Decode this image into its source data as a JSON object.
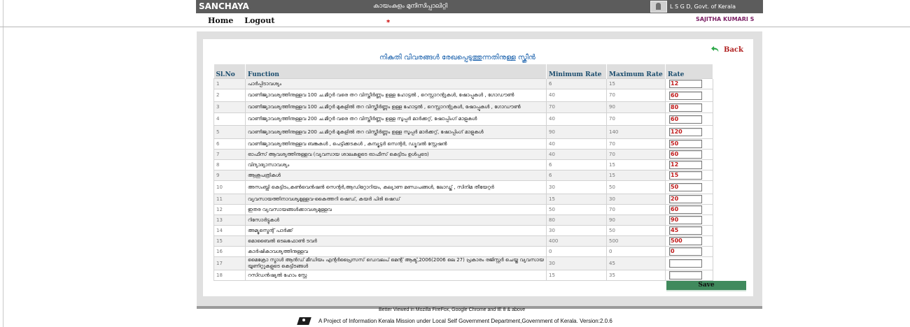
{
  "header": {
    "app_name": "SANCHAYA",
    "org_name": "കായംകുളം മുനിസിപ്പാലിറ്റി",
    "gov_name": "L S G D, Govt. of Kerala"
  },
  "user": {
    "name": "SAJITHA KUMARI S"
  },
  "nav": {
    "home": "Home",
    "logout": "Logout",
    "required_marker": "*"
  },
  "page": {
    "title": "നികുതി വിവരങ്ങൾ രേഖപ്പെടുത്തുന്നതിനുള്ള സ്ക്രീൻ",
    "back": "Back"
  },
  "table": {
    "headers": [
      "Sl.No",
      "Function",
      "Minimum Rate",
      "Maximum Rate",
      "Rate"
    ],
    "rows": [
      {
        "sl": "1",
        "fn": "പാർപ്പിടാവശ്യം",
        "min": "6",
        "max": "15",
        "rate": "12"
      },
      {
        "sl": "2",
        "fn": "വാണിജ്യാവശ്യത്തിനുള്ളവ 100 ച.മീറ്റർ വരെ തറ വിസ്തീർണ്ണം ഉള്ള ഹോട്ടൽ , റെസ്റ്റാറന്റുകൾ, ഷോപ്പുകൾ , ഗോഡൗൺ",
        "min": "40",
        "max": "70",
        "rate": "60"
      },
      {
        "sl": "3",
        "fn": "വാണിജ്യാവശ്യത്തിനുള്ളവ 100 ച.മീറ്റർ മുകളിൽ തറ വിസ്തീർണ്ണം ഉള്ള ഹോട്ടൽ , റെസ്റ്റാറന്റുകൾ, ഷോപ്പുകൾ , ഗോഡൗൺ",
        "min": "70",
        "max": "90",
        "rate": "80"
      },
      {
        "sl": "4",
        "fn": "വാണിജ്യാവശ്യത്തിനുള്ളവ 200 ച.മീറ്റർ വരെ തറ വിസ്തീർണ്ണം ഉള്ള സൂപ്പർ മാർക്കറ്റ്, ഷോപ്പിംഗ് മാളുകൾ",
        "min": "40",
        "max": "70",
        "rate": "60"
      },
      {
        "sl": "5",
        "fn": "വാണിജ്യാവശ്യത്തിനുള്ളവ 200 ച.മീറ്റർ മുകളിൽ തറ വിസ്തീർണ്ണം ഉള്ള സൂപ്പർ മാർക്കറ്റ്, ഷോപ്പിംഗ് മാളുകൾ",
        "min": "90",
        "max": "140",
        "rate": "120"
      },
      {
        "sl": "6",
        "fn": "വാണിജ്യാവശ്യത്തിനുള്ളവ ബങ്കുകൾ , പെട്ടിക്കടകൾ , കമ്പ്യൂട്ടർ സെന്റർ, ഡ്യൂവൽ സ്റ്റേഷൻ",
        "min": "40",
        "max": "70",
        "rate": "50"
      },
      {
        "sl": "7",
        "fn": "ഓഫീസ് ആവശ്യത്തിനുള്ളവ (വ്യവസായ ശാലകളുടെ ഓഫീസ് കെട്ടിടം ഉൾപ്പടെ)",
        "min": "40",
        "max": "70",
        "rate": "60"
      },
      {
        "sl": "8",
        "fn": "വിദ്യാഭ്യാസാവശ്യം",
        "min": "6",
        "max": "15",
        "rate": "12"
      },
      {
        "sl": "9",
        "fn": "ആശുപത്രികൾ",
        "min": "6",
        "max": "15",
        "rate": "15"
      },
      {
        "sl": "10",
        "fn": "അസംബ്ലി കെട്ടിടം,കൺവെൻഷൻ സെന്റർ,ആഡിറ്റോറിയം, കല്യാണ മണ്ഡപങ്ങൾ, ലോഡ്ജ് , സിനിമ തീയേറ്റർ",
        "min": "30",
        "max": "50",
        "rate": "50"
      },
      {
        "sl": "11",
        "fn": "വ്യവസായത്തിനാവശ്യമുള്ളവ-കൈത്തറി ഷെഡ്, കയർ പിരി ഷെഡ്",
        "min": "15",
        "max": "30",
        "rate": "20"
      },
      {
        "sl": "12",
        "fn": "ഇതര വ്യവസായങ്ങൾക്കാവശ്യമുള്ളവ",
        "min": "50",
        "max": "70",
        "rate": "60"
      },
      {
        "sl": "13",
        "fn": "റിസോർട്ടുകൾ",
        "min": "80",
        "max": "90",
        "rate": "90"
      },
      {
        "sl": "14",
        "fn": "അമ്യൂസ്മെന്റ് പാർക്ക്",
        "min": "30",
        "max": "50",
        "rate": "45"
      },
      {
        "sl": "15",
        "fn": "മൊബൈൽ ടെലഫോൺ ടവർ",
        "min": "400",
        "max": "500",
        "rate": "500"
      },
      {
        "sl": "16",
        "fn": "കാർഷികാവശ്യത്തിനുള്ളവ",
        "min": "0",
        "max": "0",
        "rate": "0"
      },
      {
        "sl": "17",
        "fn": "മൈക്രോ സ്മാൾ ആൻഡ് മീഡിയം എന്റർപ്രൈസസ് ഡെവലപ് മെന്റ് ആക്ട്,2006(2006 ലെ 27) പ്രകാരം രജിസ്റ്റർ ചെയ്ത വ്യവസായ യൂണിറ്റുകളുടെ കെട്ടിടങ്ങൾ",
        "min": "30",
        "max": "45",
        "rate": ""
      },
      {
        "sl": "18",
        "fn": "റസിഡൻഷ്യൽ ഹോം സ്റ്റേ",
        "min": "15",
        "max": "35",
        "rate": ""
      }
    ]
  },
  "actions": {
    "save": "Save"
  },
  "footer": {
    "line1": "Better Viewed in Mozilla FireFox, Google Chrome and IE 8 & above",
    "line2": "A Project of Information Kerala Mission under Local Self Government Department,Government of Kerala. Version:2.0.6"
  },
  "colors": {
    "header_bg": "#5c5c5c",
    "table_header": "#1a4c6d",
    "rate_text": "#c01818",
    "save_bg": "#408a5d",
    "title_blue": "#2468b0"
  }
}
